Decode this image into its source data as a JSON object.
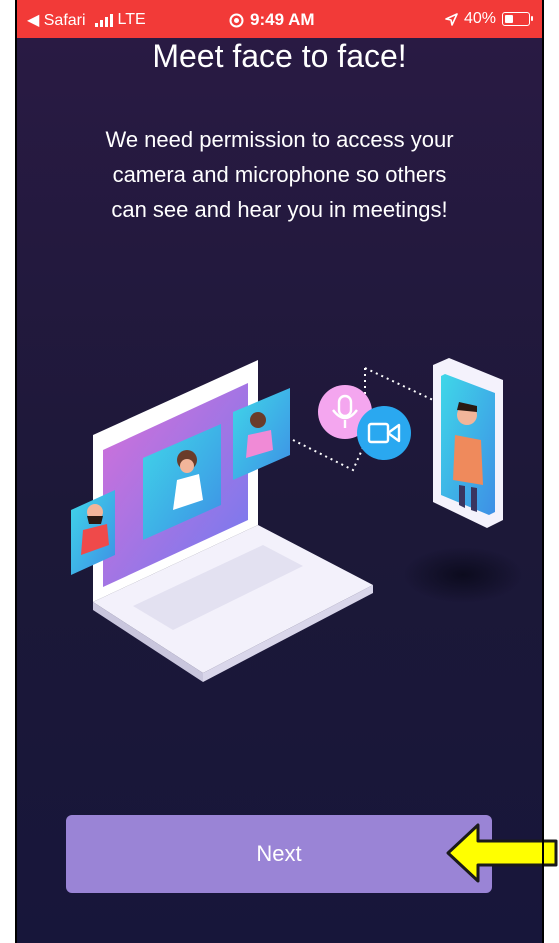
{
  "status_bar": {
    "back_label": "◀ Safari",
    "network": "LTE",
    "time": "9:49 AM",
    "battery": "40%"
  },
  "onboarding": {
    "title": "Meet face to face!",
    "description_lines": [
      "We need permission to access your",
      "camera and microphone so others",
      "can see and hear you in meetings!"
    ],
    "next_label": "Next"
  },
  "colors": {
    "status_bar": "#f23a38",
    "background": "#1c1838",
    "button": "#9a84d6",
    "annotation_arrow": "#ffff00"
  },
  "icons": [
    "location-icon",
    "signal-icon",
    "battery-icon",
    "microphone-icon",
    "video-camera-icon",
    "arrow-pointer-icon"
  ]
}
